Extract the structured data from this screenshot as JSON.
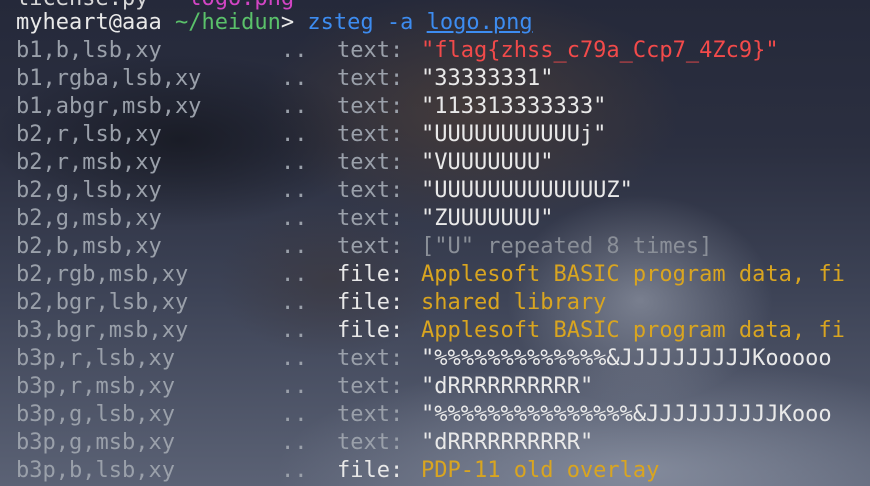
{
  "terminal": {
    "cut_line": {
      "text": "license.py",
      "file": "logo.png"
    },
    "prompt": {
      "user_host": "myheart@aaa",
      "path": "~/heidun",
      "arrow": ">",
      "command": "zsteg",
      "flag": "-a",
      "argument": "logo.png"
    },
    "rows": [
      {
        "label": "b1,b,lsb,xy",
        "dots": "..",
        "kind": "text:",
        "value": "\"flag{zhss_c79a_Ccp7_4Zc9}\"",
        "style": "flag"
      },
      {
        "label": "b1,rgba,lsb,xy",
        "dots": "..",
        "kind": "text:",
        "value": "\"33333331\"",
        "style": "plain"
      },
      {
        "label": "b1,abgr,msb,xy",
        "dots": "..",
        "kind": "text:",
        "value": "\"113313333333\"",
        "style": "plain"
      },
      {
        "label": "b2,r,lsb,xy",
        "dots": "..",
        "kind": "text:",
        "value": "\"UUUUUUUUUUUj\"",
        "style": "plain"
      },
      {
        "label": "b2,r,msb,xy",
        "dots": "..",
        "kind": "text:",
        "value": "\"VUUUUUUU\"",
        "style": "plain"
      },
      {
        "label": "b2,g,lsb,xy",
        "dots": "..",
        "kind": "text:",
        "value": "\"UUUUUUUUUUUUUZ\"",
        "style": "plain"
      },
      {
        "label": "b2,g,msb,xy",
        "dots": "..",
        "kind": "text:",
        "value": "\"ZUUUUUUU\"",
        "style": "plain"
      },
      {
        "label": "b2,b,msb,xy",
        "dots": "..",
        "kind": "text:",
        "value": "[\"U\" repeated 8 times]",
        "style": "dim"
      },
      {
        "label": "b2,rgb,msb,xy",
        "dots": "..",
        "kind": "file:",
        "value": "Applesoft BASIC program data, fi",
        "style": "file"
      },
      {
        "label": "b2,bgr,lsb,xy",
        "dots": "..",
        "kind": "file:",
        "value": "shared library",
        "style": "file"
      },
      {
        "label": "b3,bgr,msb,xy",
        "dots": "..",
        "kind": "file:",
        "value": "Applesoft BASIC program data, fi",
        "style": "file"
      },
      {
        "label": "b3p,r,lsb,xy",
        "dots": "..",
        "kind": "text:",
        "value": "\"%%%%%%%%%%%%%&JJJJJJJJJJKooooo",
        "style": "plain"
      },
      {
        "label": "b3p,r,msb,xy",
        "dots": "..",
        "kind": "text:",
        "value": "\"dRRRRRRRRRR\"",
        "style": "plain"
      },
      {
        "label": "b3p,g,lsb,xy",
        "dots": "..",
        "kind": "text:",
        "value": "\"%%%%%%%%%%%%%%%&JJJJJJJJJJKooo",
        "style": "plain"
      },
      {
        "label": "b3p,g,msb,xy",
        "dots": "..",
        "kind": "text:",
        "value": "\"dRRRRRRRRRR\"",
        "style": "plain"
      },
      {
        "label": "b3p,b,lsb,xy",
        "dots": "..",
        "kind": "file:",
        "value": "PDP-11 old overlay",
        "style": "file"
      }
    ]
  }
}
